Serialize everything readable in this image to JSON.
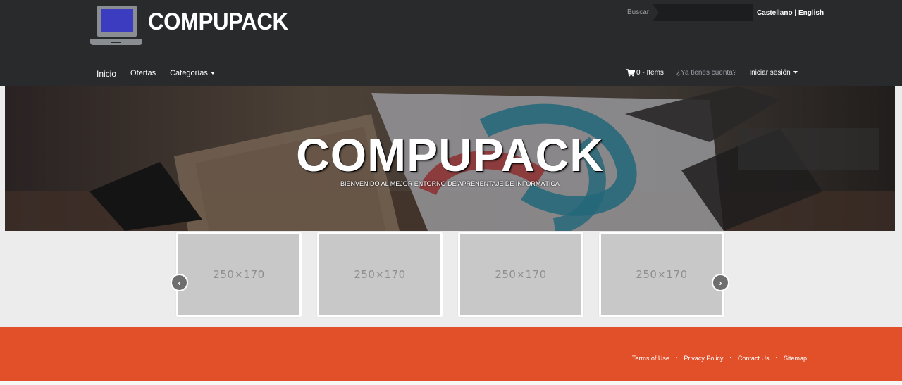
{
  "header": {
    "logo_text": "COMPUPACK",
    "search_label": "Buscar",
    "search_placeholder": "",
    "lang_es": "Castellano",
    "lang_sep": " | ",
    "lang_en": "English"
  },
  "nav": {
    "home": "Inicio",
    "offers": "Ofertas",
    "categories": "Categorías",
    "cart": "0 - Items",
    "have_account": "¿Ya tienes cuenta?",
    "login": "Iniciar sesión"
  },
  "hero": {
    "title": "COMPUPACK",
    "subtitle": "BIENVENIDO AL MEJOR ENTORNO DE APRENENTAJE DE INFORMÁTICA"
  },
  "carousel": {
    "items": [
      {
        "label": "250×170"
      },
      {
        "label": "250×170"
      },
      {
        "label": "250×170"
      },
      {
        "label": "250×170"
      }
    ],
    "prev_label": "‹",
    "next_label": "›"
  },
  "footer": {
    "terms": "Terms of Use",
    "privacy": "Privacy Policy",
    "contact": "Contact Us",
    "sitemap": "Sitemap",
    "separator": ":"
  },
  "colors": {
    "header_bg": "#282a2c",
    "footer_bg": "#e2502a",
    "page_bg": "#ececec"
  }
}
